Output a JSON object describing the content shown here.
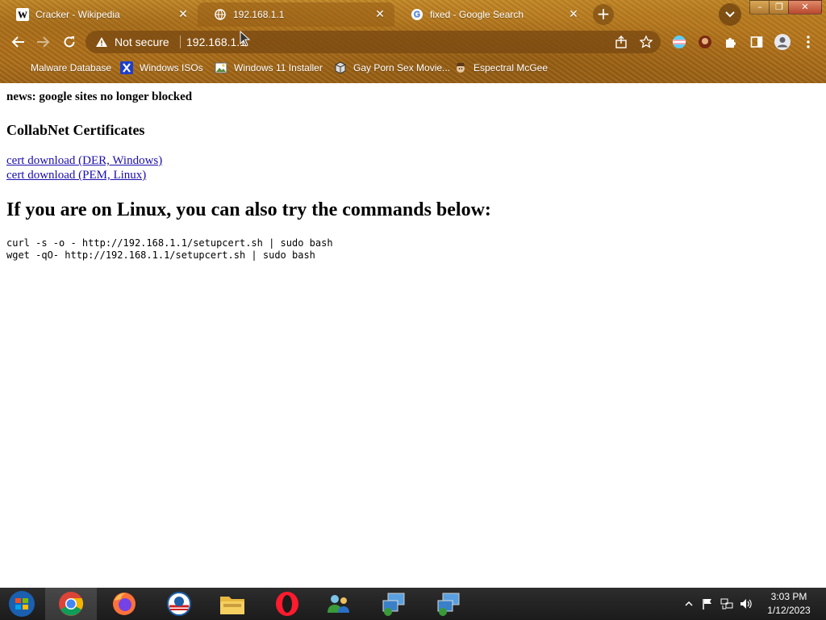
{
  "browser": {
    "tabs": [
      {
        "title": "Cracker - Wikipedia",
        "favicon": "wikipedia-icon",
        "active": false
      },
      {
        "title": "192.168.1.1",
        "favicon": "globe-icon",
        "active": true
      },
      {
        "title": "fixed - Google Search",
        "favicon": "google-icon",
        "active": false
      }
    ],
    "new_tab_label": "+",
    "security_label": "Not secure",
    "url": "192.168.1.1",
    "bookmarks": [
      {
        "label": "Malware Database",
        "icon": "none"
      },
      {
        "label": "Windows ISOs",
        "icon": "x-logo-icon"
      },
      {
        "label": "Windows 11 Installer",
        "icon": "image-icon"
      },
      {
        "label": "Gay Porn Sex Movie...",
        "icon": "cube-icon"
      },
      {
        "label": "Espectral McGee",
        "icon": "character-icon"
      }
    ],
    "theme_color": "#b8781e"
  },
  "page": {
    "news": "news: google sites no longer blocked",
    "certs_heading": "CollabNet Certificates",
    "links": [
      "cert download (DER, Windows)",
      "cert download (PEM, Linux)"
    ],
    "linux_heading": "If you are on Linux, you can also try the commands below:",
    "commands": [
      "curl -s -o - http://192.168.1.1/setupcert.sh | sudo bash",
      "wget -qO- http://192.168.1.1/setupcert.sh | sudo bash"
    ],
    "link_color": "#1a0dab"
  },
  "taskbar": {
    "apps": [
      "start-orb",
      "chrome",
      "firefox",
      "obama-logo",
      "file-explorer",
      "opera",
      "network-users",
      "remote-desktop",
      "remote-desktop-2"
    ],
    "time": "3:03 PM",
    "date": "1/12/2023"
  }
}
